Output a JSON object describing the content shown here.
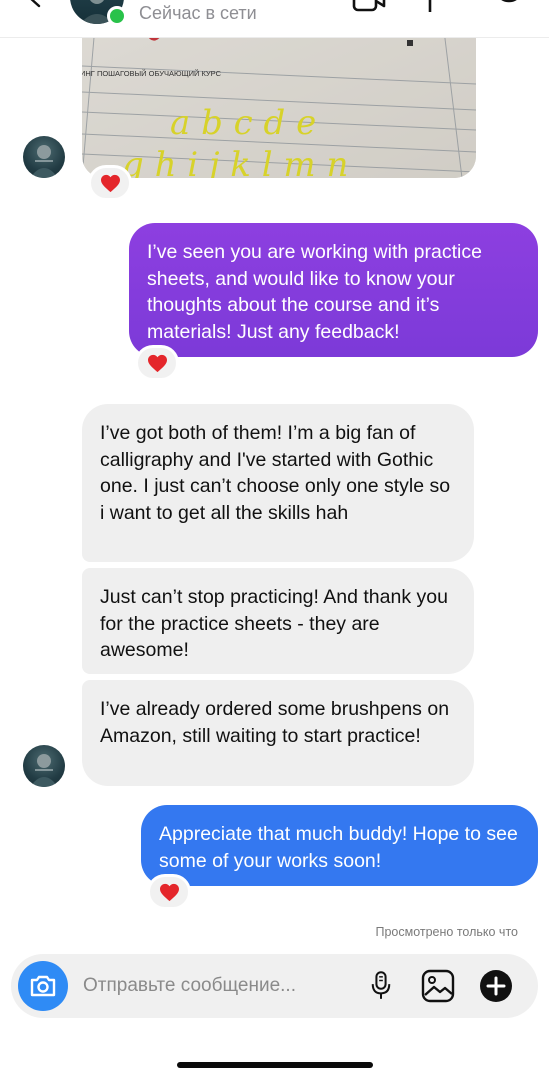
{
  "header": {
    "status": "Сейчас в сети",
    "icons": [
      "back-chevron-icon",
      "video-call-icon",
      "flag-icon",
      "info-icon"
    ]
  },
  "messages": {
    "sent1": "I’ve seen you are working with practice sheets, and would like to know your thoughts about the course and it’s materials! Just any feedback!",
    "recv1": "I’ve got both of them! I’m a big fan of calligraphy and I've started with Gothic one. I just can’t choose only one style so i want to get all the skills hah",
    "recv2": "Just can’t stop practicing! And thank you for the practice sheets - they are awesome!",
    "recv3": "I’ve already ordered some brushpens on Amazon, still waiting to start practice!",
    "sent2": "Appreciate that much buddy! Hope to see some of your works soon!"
  },
  "image_message": {
    "caption": "ИНГ ПОШАГОВЫЙ ОБУЧАЮЩИЙ КУРС",
    "letters_row1": "a b c d e",
    "letters_row2": "g h i j k l m n"
  },
  "reactions": {
    "emoji": "❤️"
  },
  "seen": "Просмотрено только что",
  "composer": {
    "placeholder": "Отправьте сообщение...",
    "icons": [
      "camera-icon",
      "microphone-icon",
      "gallery-icon",
      "add-icon"
    ]
  },
  "colors": {
    "purple_bubble": "#8d3fe0",
    "blue_bubble": "#3478f0",
    "received_bubble": "#efefef",
    "online": "#29c24a",
    "camera_button": "#2f8bf5",
    "heart": "#e4262b"
  }
}
